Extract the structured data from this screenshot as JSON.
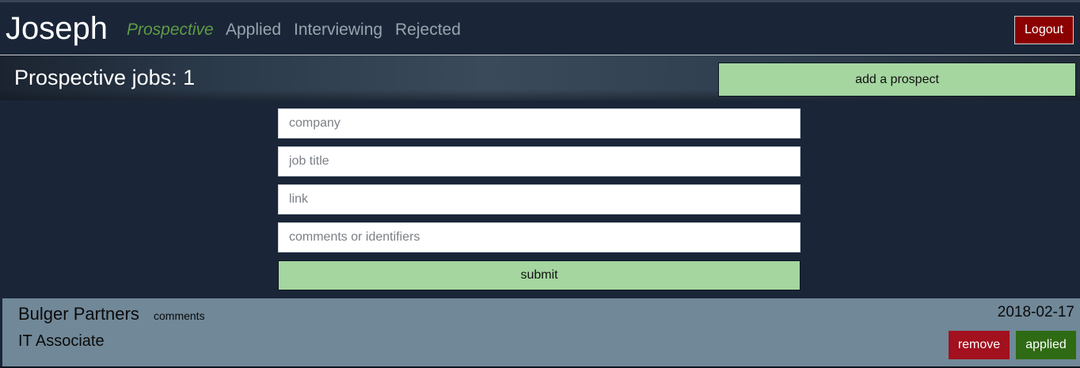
{
  "header": {
    "brand": "Joseph",
    "nav": [
      {
        "label": "Prospective",
        "active": true
      },
      {
        "label": "Applied",
        "active": false
      },
      {
        "label": "Interviewing",
        "active": false
      },
      {
        "label": "Rejected",
        "active": false
      }
    ],
    "logout_label": "Logout"
  },
  "banner": {
    "count_label": "Prospective jobs: 1",
    "add_label": "add a prospect"
  },
  "form": {
    "company_placeholder": "company",
    "job_title_placeholder": "job title",
    "link_placeholder": "link",
    "comments_placeholder": "comments or identifiers",
    "submit_label": "submit"
  },
  "jobs": [
    {
      "company": "Bulger Partners",
      "comments_label": "comments",
      "title": "IT Associate",
      "date": "2018-02-17",
      "remove_label": "remove",
      "applied_label": "applied"
    }
  ],
  "colors": {
    "background": "#1a2638",
    "accent_green": "#a5d6a0",
    "active_nav": "#5f9b45",
    "logout": "#8b0000",
    "remove": "#a3101e",
    "applied": "#2f6a14",
    "card": "#708898"
  }
}
